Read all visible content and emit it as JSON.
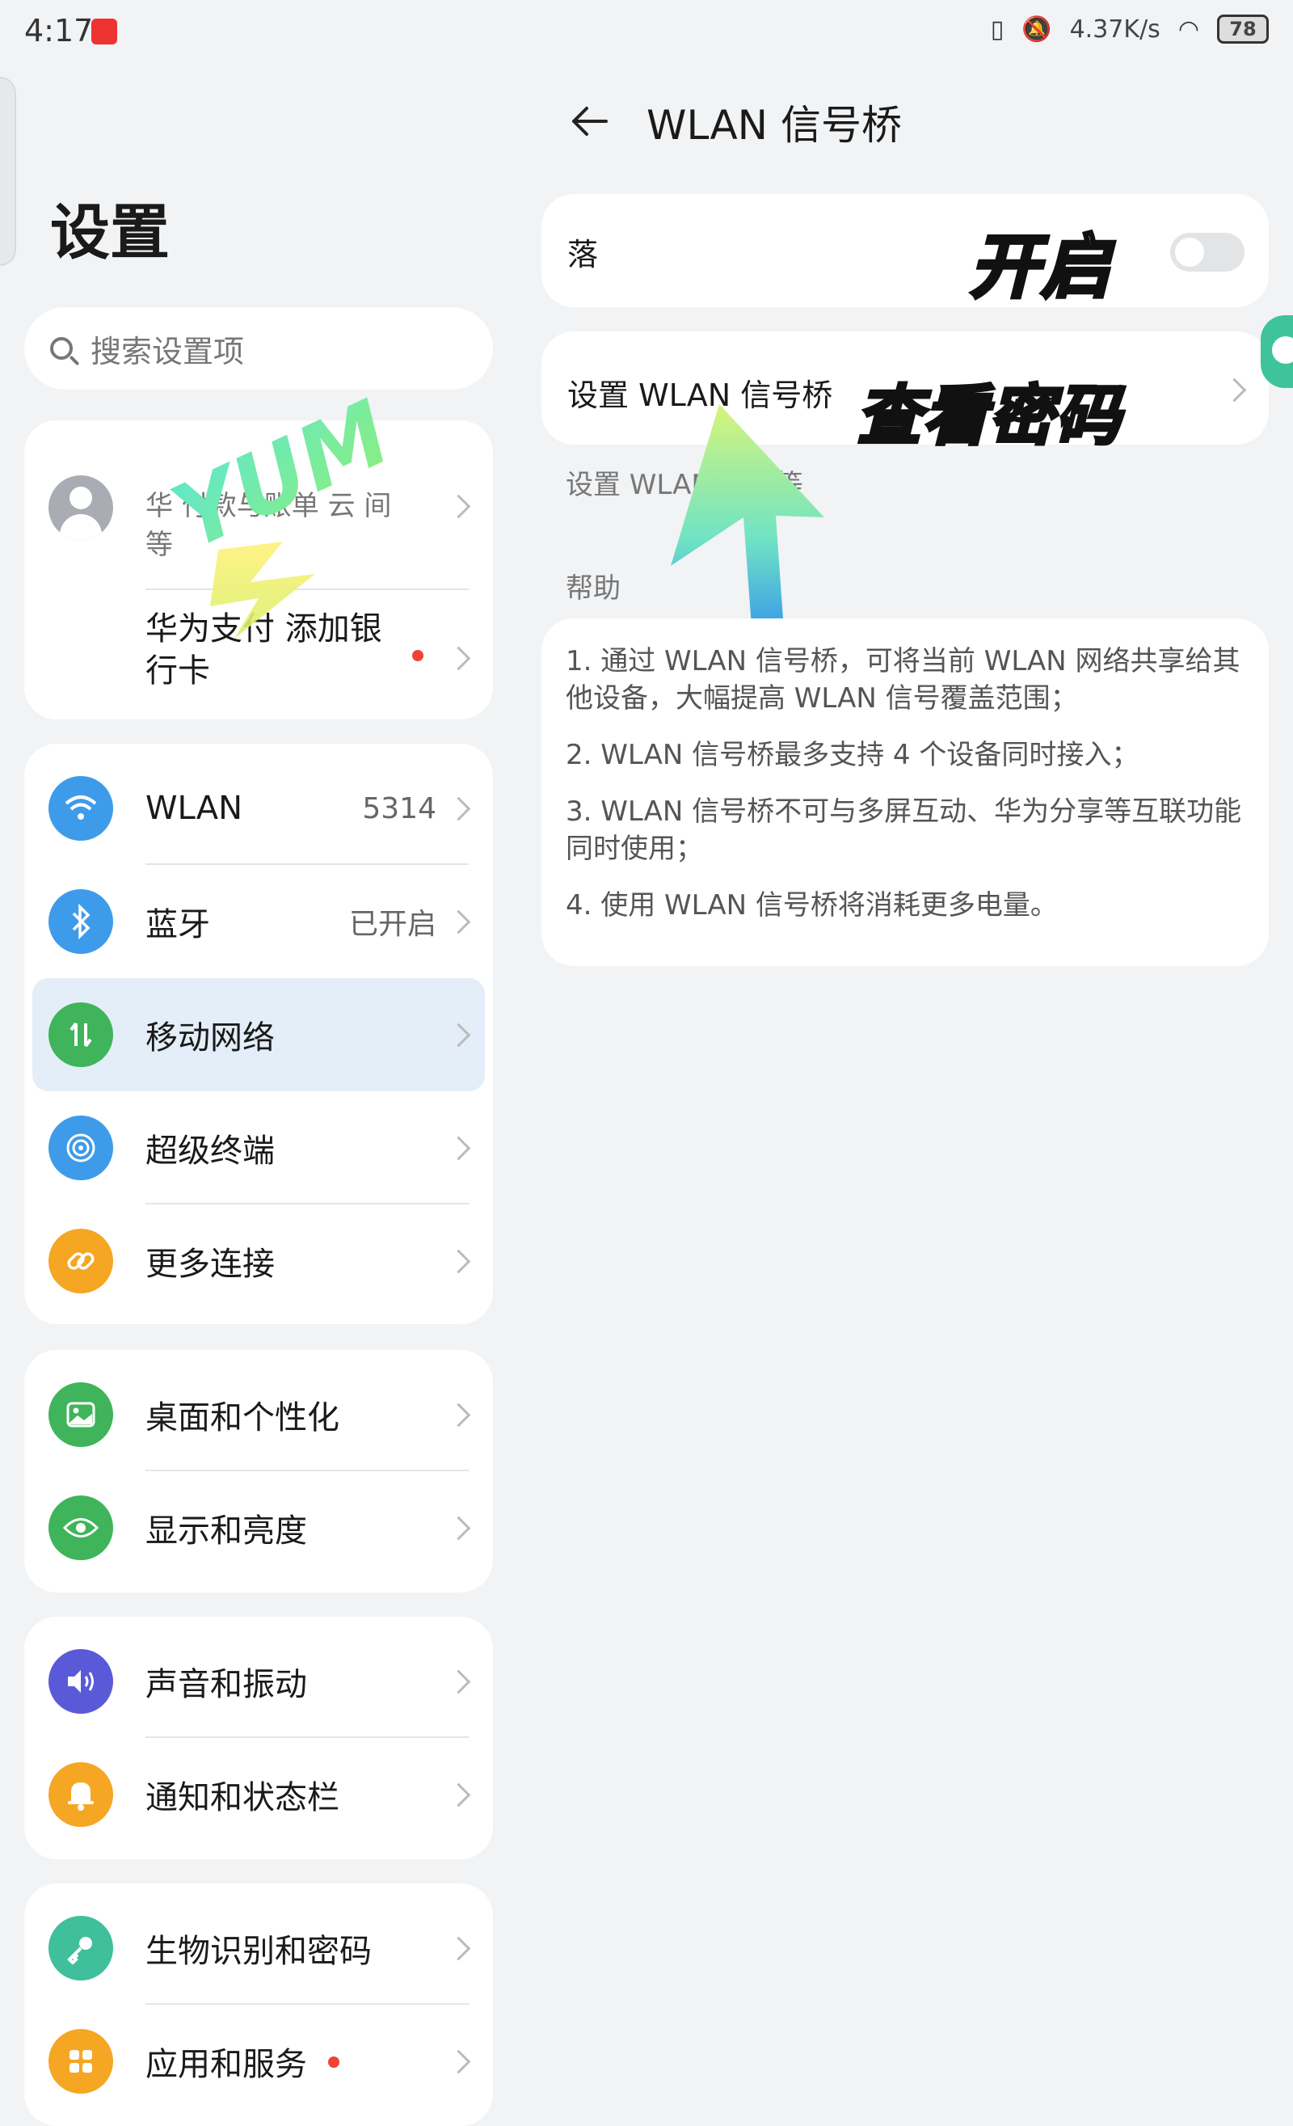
{
  "status": {
    "time": "4:17",
    "speed": "4.37K/s",
    "battery": "78"
  },
  "left": {
    "title": "设置",
    "search_placeholder": "搜索设置项",
    "account": {
      "sub": "华 付款与账单 云 间等",
      "pay": "华为支付 添加银行卡"
    },
    "group1": [
      {
        "label": "WLAN",
        "value": "5314",
        "icon": "wifi-icon",
        "color": "#3e9be9"
      },
      {
        "label": "蓝牙",
        "value": "已开启",
        "icon": "bluetooth-icon",
        "color": "#3e9be9"
      },
      {
        "label": "移动网络",
        "value": "",
        "icon": "mobile-data-icon",
        "color": "#3fb45a"
      },
      {
        "label": "超级终端",
        "value": "",
        "icon": "super-device-icon",
        "color": "#3e9be9"
      },
      {
        "label": "更多连接",
        "value": "",
        "icon": "link-icon",
        "color": "#f5a623"
      }
    ],
    "group2": [
      {
        "label": "桌面和个性化",
        "icon": "wallpaper-icon",
        "color": "#3fb45a"
      },
      {
        "label": "显示和亮度",
        "icon": "eye-icon",
        "color": "#3fb45a"
      }
    ],
    "group3": [
      {
        "label": "声音和振动",
        "icon": "sound-icon",
        "color": "#5a5ad8"
      },
      {
        "label": "通知和状态栏",
        "icon": "bell-icon",
        "color": "#f5a623"
      }
    ],
    "group4": [
      {
        "label": "生物识别和密码",
        "icon": "key-icon",
        "color": "#3fbf9c"
      },
      {
        "label": "应用和服务",
        "icon": "apps-icon",
        "color": "#f5a623"
      }
    ]
  },
  "right": {
    "title": "WLAN 信号桥",
    "toggle_label": "落",
    "stamp_on": "开启",
    "setup_label": "设置 WLAN 信号桥",
    "stamp_pwd": "查看密码",
    "setup_desc": "设置 WLAN          密码等",
    "help_header": "帮助",
    "help": [
      "1. 通过 WLAN 信号桥，可将当前 WLAN 网络共享给其他设备，大幅提高 WLAN 信号覆盖范围；",
      "2. WLAN 信号桥最多支持 4 个设备同时接入；",
      "3. WLAN 信号桥不可与多屏互动、华为分享等互联功能同时使用；",
      "4. 使用 WLAN 信号桥将消耗更多电量。"
    ]
  },
  "watermark": "YUM"
}
